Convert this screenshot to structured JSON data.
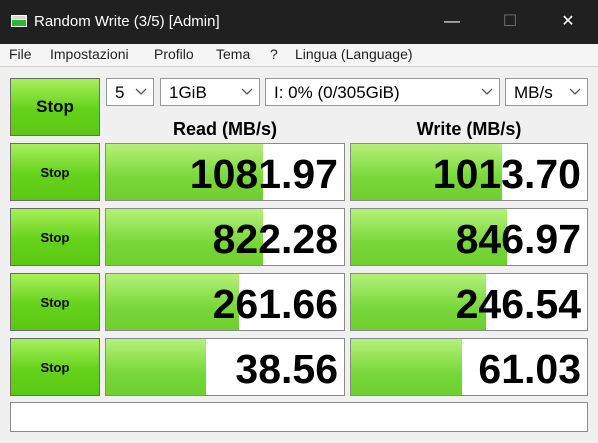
{
  "window": {
    "title": "Random Write (3/5) [Admin]",
    "controls": {
      "minimize": "—",
      "maximize": "☐",
      "close": "✕"
    }
  },
  "menu": [
    "File",
    "Impostazioni",
    "Profilo",
    "Tema",
    "?",
    "Lingua (Language)"
  ],
  "controls": {
    "all_button_label": "Stop",
    "count": "5",
    "size": "1GiB",
    "drive": "I: 0% (0/305GiB)",
    "unit": "MB/s"
  },
  "headers": {
    "read": "Read (MB/s)",
    "write": "Write (MB/s)"
  },
  "rows": [
    {
      "button": "Stop",
      "read": "1081.97",
      "write": "1013.70",
      "read_fill": 0.66,
      "write_fill": 0.64
    },
    {
      "button": "Stop",
      "read": "822.28",
      "write": "846.97",
      "read_fill": 0.66,
      "write_fill": 0.66
    },
    {
      "button": "Stop",
      "read": "261.66",
      "write": "246.54",
      "read_fill": 0.56,
      "write_fill": 0.57
    },
    {
      "button": "Stop",
      "read": "38.56",
      "write": "61.03",
      "read_fill": 0.42,
      "write_fill": 0.47
    }
  ],
  "status_text": "",
  "colors": {
    "bar_green": "#78d83a",
    "button_green": "#64d21a",
    "titlebar": "#202020"
  },
  "icons": [
    "drive-icon",
    "minimize-icon",
    "maximize-icon",
    "close-icon",
    "chevron-down-icon"
  ]
}
